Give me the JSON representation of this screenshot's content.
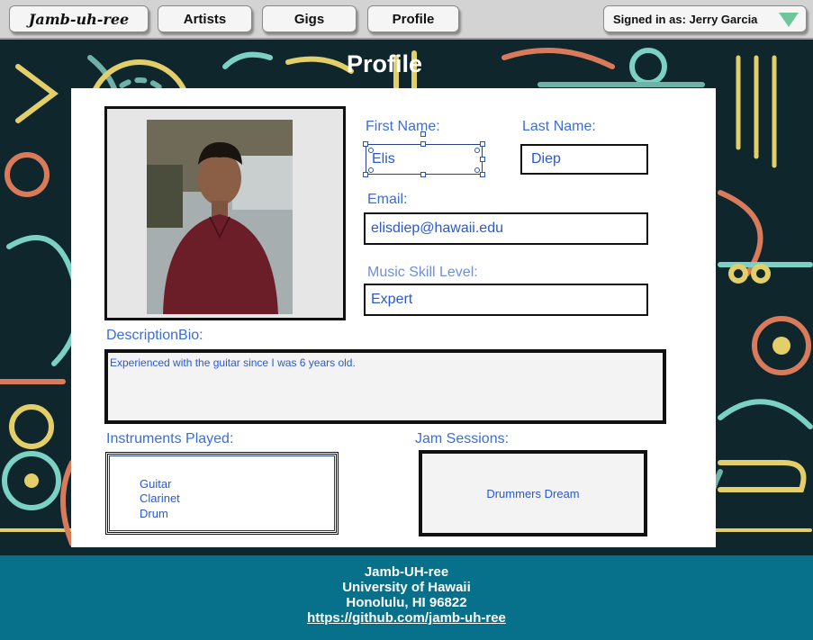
{
  "nav": {
    "brand": "Jamb-uh-ree",
    "items": [
      "Artists",
      "Gigs",
      "Profile"
    ],
    "signed_in": "Signed in as: Jerry Garcia"
  },
  "page": {
    "title": "Profile"
  },
  "profile": {
    "first_name_label": "First Name:",
    "first_name": "Elis",
    "last_name_label": "Last Name:",
    "last_name": "Diep",
    "email_label": "Email:",
    "email": "elisdiep@hawaii.edu",
    "skill_label": "Music Skill Level:",
    "skill": "Expert",
    "bio_label": "DescriptionBio:",
    "bio": "Experienced with the guitar since I was 6 years old.",
    "instruments_label": "Instruments Played:",
    "instruments": [
      "Guitar",
      "Clarinet",
      "Drum"
    ],
    "jam_label": "Jam Sessions:",
    "jam_sessions": [
      "Drummers Dream"
    ]
  },
  "footer": {
    "line1": "Jamb-UH-ree",
    "line2": "University of Hawaii",
    "line3": "Honolulu, HI 96822",
    "link": "https://github.com/jamb-uh-ree"
  },
  "colors": {
    "accent_blue": "#2a59d4",
    "footer_bg": "#07708a",
    "nav_bg": "#d3d3d3",
    "signin_triangle": "#6ec79a"
  }
}
